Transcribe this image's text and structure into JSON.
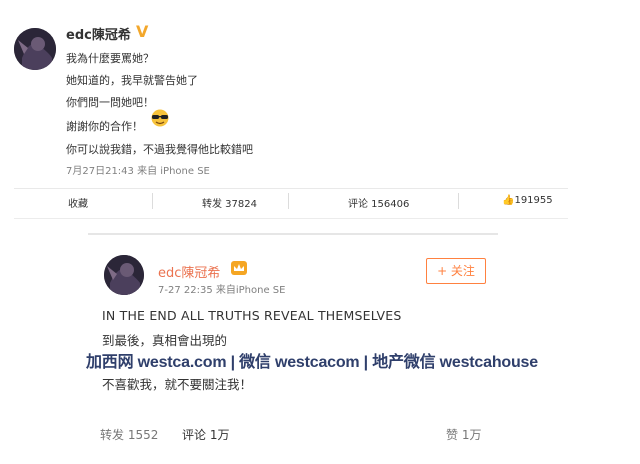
{
  "post1": {
    "username": "edc陳冠希",
    "lines": [
      "我為什麼要罵她？",
      "她知道的，我早就警告她了",
      "你們問一問她吧！",
      "謝謝你的合作！",
      "你可以說我錯，不過我覺得他比較錯吧"
    ],
    "meta": "7月27日21:43 来自 iPhone SE",
    "actions": {
      "save": "收藏",
      "repost": "转发 37824",
      "comment": "评论 156406",
      "like": "191955"
    }
  },
  "post2": {
    "username": "edc陳冠希",
    "meta": "7-27 22:35  来自iPhone SE",
    "follow_label": "+ 关注",
    "text_en": "IN THE END ALL TRUTHS REVEAL THEMSELVES",
    "text_zh1": "到最後，真相會出現的",
    "text_zh2": "不喜歡我，就不要關注我！",
    "footer": {
      "repost": "转发 1552",
      "comment": "评论 1万",
      "like": "赞 1万"
    }
  },
  "watermark": "加西网 westca.com | 微信 westcacom | 地产微信 westcahouse",
  "colors": {
    "accent": "#ff8140",
    "verified": "#f3a72b",
    "name2": "#eb7350"
  }
}
